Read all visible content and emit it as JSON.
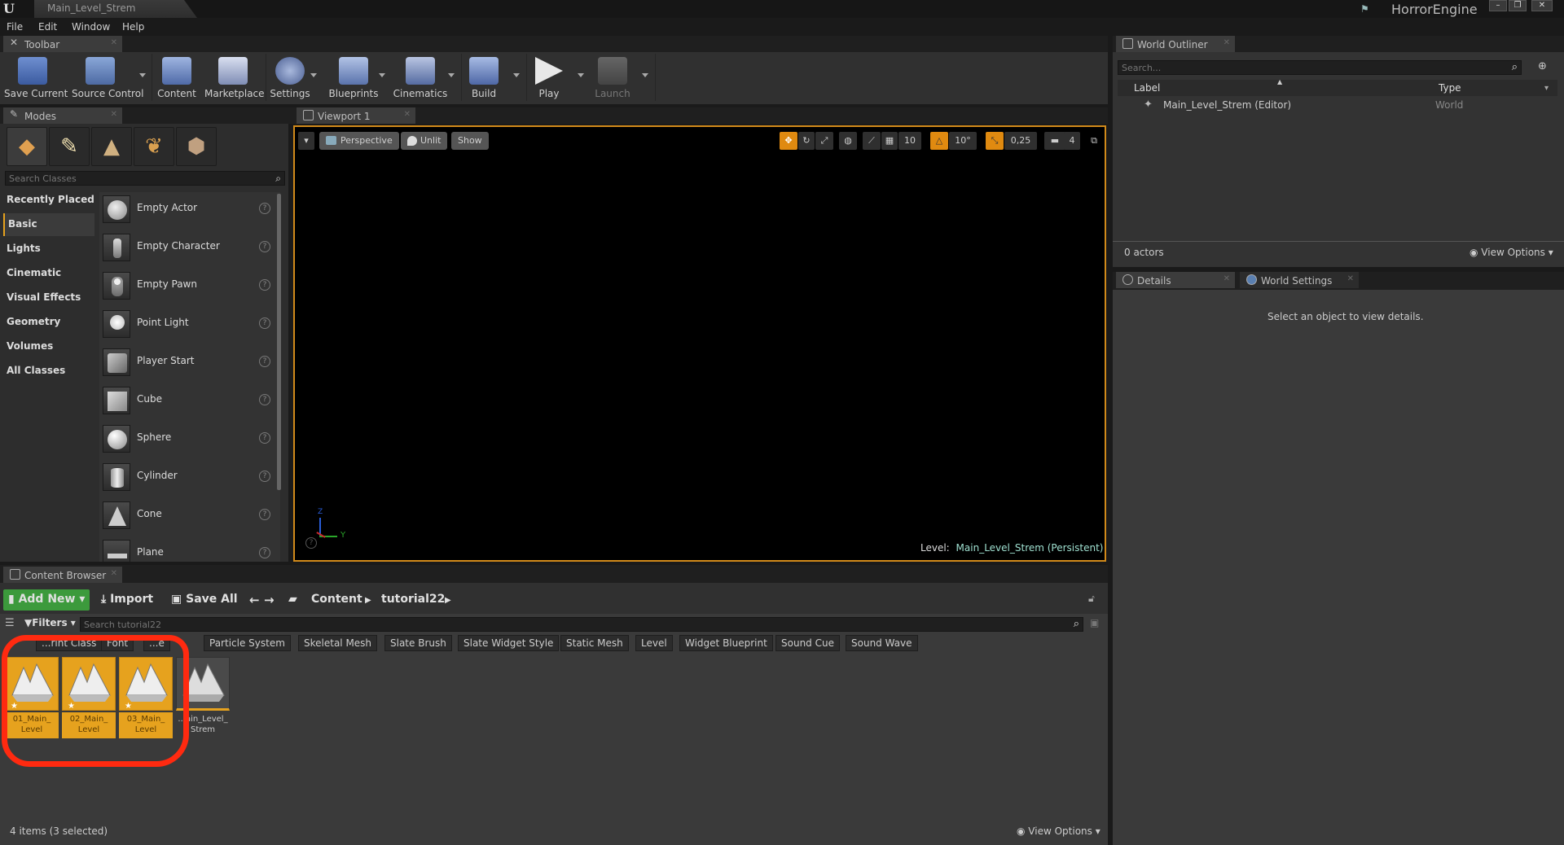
{
  "window": {
    "tab_title": "Main_Level_Strem",
    "app_name": "HorrorEngine"
  },
  "menu": [
    "File",
    "Edit",
    "Window",
    "Help"
  ],
  "toolbar": {
    "tab_label": "Toolbar",
    "buttons": [
      {
        "label": "Save Current",
        "icon": "save-icon"
      },
      {
        "label": "Source Control",
        "icon": "source-control-icon"
      },
      {
        "label": "Content",
        "icon": "content-icon"
      },
      {
        "label": "Marketplace",
        "icon": "marketplace-icon"
      },
      {
        "label": "Settings",
        "icon": "settings-icon"
      },
      {
        "label": "Blueprints",
        "icon": "blueprints-icon"
      },
      {
        "label": "Cinematics",
        "icon": "cinematics-icon"
      },
      {
        "label": "Build",
        "icon": "build-icon"
      },
      {
        "label": "Play",
        "icon": "play-icon"
      },
      {
        "label": "Launch",
        "icon": "launch-icon"
      }
    ]
  },
  "modes": {
    "tab_label": "Modes",
    "search_placeholder": "Search Classes",
    "categories": [
      "Recently Placed",
      "Basic",
      "Lights",
      "Cinematic",
      "Visual Effects",
      "Geometry",
      "Volumes",
      "All Classes"
    ],
    "selected_category": "Basic",
    "items": [
      "Empty Actor",
      "Empty Character",
      "Empty Pawn",
      "Point Light",
      "Player Start",
      "Cube",
      "Sphere",
      "Cylinder",
      "Cone",
      "Plane"
    ]
  },
  "viewport": {
    "tab_label": "Viewport 1",
    "perspective_label": "Perspective",
    "unlit_label": "Unlit",
    "show_label": "Show",
    "grid_snap": "10",
    "rotation_snap": "10°",
    "scale_snap": "0,25",
    "camera_speed": "4",
    "level_prefix": "Level:",
    "level_name": "Main_Level_Strem (Persistent)",
    "axis_z": "Z",
    "axis_y": "Y"
  },
  "world_outliner": {
    "tab_label": "World Outliner",
    "search_placeholder": "Search...",
    "col_label": "Label",
    "col_type": "Type",
    "rows": [
      {
        "label": "Main_Level_Strem (Editor)",
        "type": "World"
      }
    ],
    "actor_count": "0 actors",
    "view_options": "View Options"
  },
  "details": {
    "tab_details": "Details",
    "tab_world_settings": "World Settings",
    "empty_message": "Select an object to view details."
  },
  "content_browser": {
    "tab_label": "Content Browser",
    "add_new": "Add New",
    "import": "Import",
    "save_all": "Save All",
    "path": [
      "Content",
      "tutorial22"
    ],
    "filters_label": "Filters",
    "search_placeholder": "Search tutorial22",
    "filter_chips": [
      "...rint Class",
      "Font",
      "...e",
      "Particle System",
      "Skeletal Mesh",
      "Slate Brush",
      "Slate Widget Style",
      "Static Mesh",
      "Level",
      "Widget Blueprint",
      "Sound Cue",
      "Sound Wave"
    ],
    "assets": [
      {
        "name": "01_Main_ Level",
        "selected": true
      },
      {
        "name": "02_Main_ Level",
        "selected": true
      },
      {
        "name": "03_Main_ Level",
        "selected": true
      },
      {
        "name": "...ain_Level_ Strem",
        "selected": false
      }
    ],
    "status": "4 items (3 selected)",
    "view_options": "View Options"
  },
  "colors": {
    "accent_orange": "#e6a21e",
    "annotation_red": "#ff2a10",
    "add_new_green": "#3c9a3c",
    "viewport_border": "#d18a1a"
  }
}
